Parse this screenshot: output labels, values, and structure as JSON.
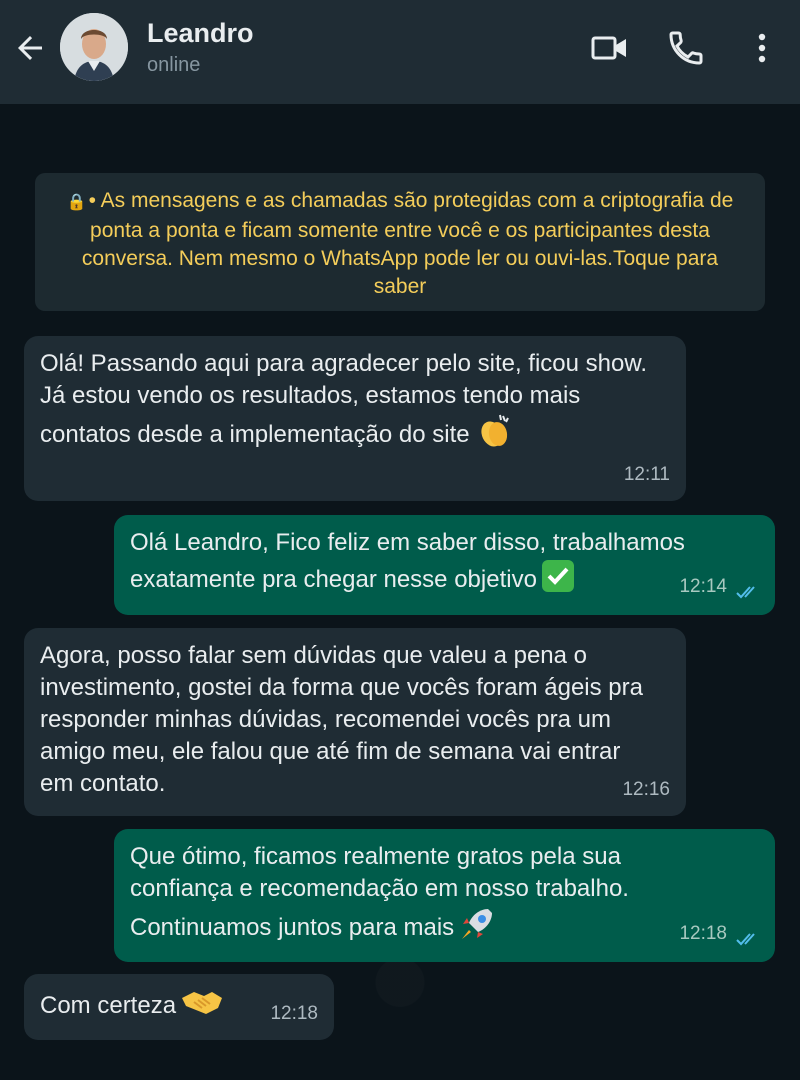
{
  "header": {
    "contact_name": "Leandro",
    "status": "online"
  },
  "notice": {
    "text": "• As mensagens e as chamadas são protegidas com a criptografia de ponta a ponta e ficam somente entre você e os participantes desta conversa. Nem mesmo o WhatsApp pode ler ou ouvi-las.Toque para saber"
  },
  "messages": [
    {
      "direction": "incoming",
      "text": "Olá! Passando aqui para agradecer pelo site, ficou show. Já estou vendo os resultados, estamos tendo mais contatos desde a implementação do site",
      "emoji": "clapping-hands",
      "time": "12:11"
    },
    {
      "direction": "outgoing",
      "text": "Olá Leandro, Fico feliz em saber disso, trabalhamos exatamente pra chegar nesse objetivo",
      "emoji": "check-mark-button",
      "time": "12:14",
      "read": true
    },
    {
      "direction": "incoming",
      "text": "Agora, posso falar sem dúvidas que valeu a pena o investimento, gostei da forma que vocês foram ágeis pra responder minhas dúvidas, recomendei vocês pra um amigo meu, ele falou que até fim de semana vai entrar em contato.",
      "time": "12:16"
    },
    {
      "direction": "outgoing",
      "text": "Que ótimo, ficamos realmente gratos pela sua confiança e recomendação em nosso trabalho. Continuamos juntos para mais",
      "emoji": "rocket",
      "time": "12:18",
      "read": true
    },
    {
      "direction": "incoming",
      "text": "Com certeza",
      "emoji": "handshake",
      "time": "12:18"
    }
  ],
  "colors": {
    "header_bg": "#1f2c34",
    "chat_bg": "#0b141a",
    "incoming_bubble": "#1f2c34",
    "outgoing_bubble": "#005c4b",
    "notice_text": "#f4cd5a",
    "read_ticks": "#53bdeb"
  }
}
